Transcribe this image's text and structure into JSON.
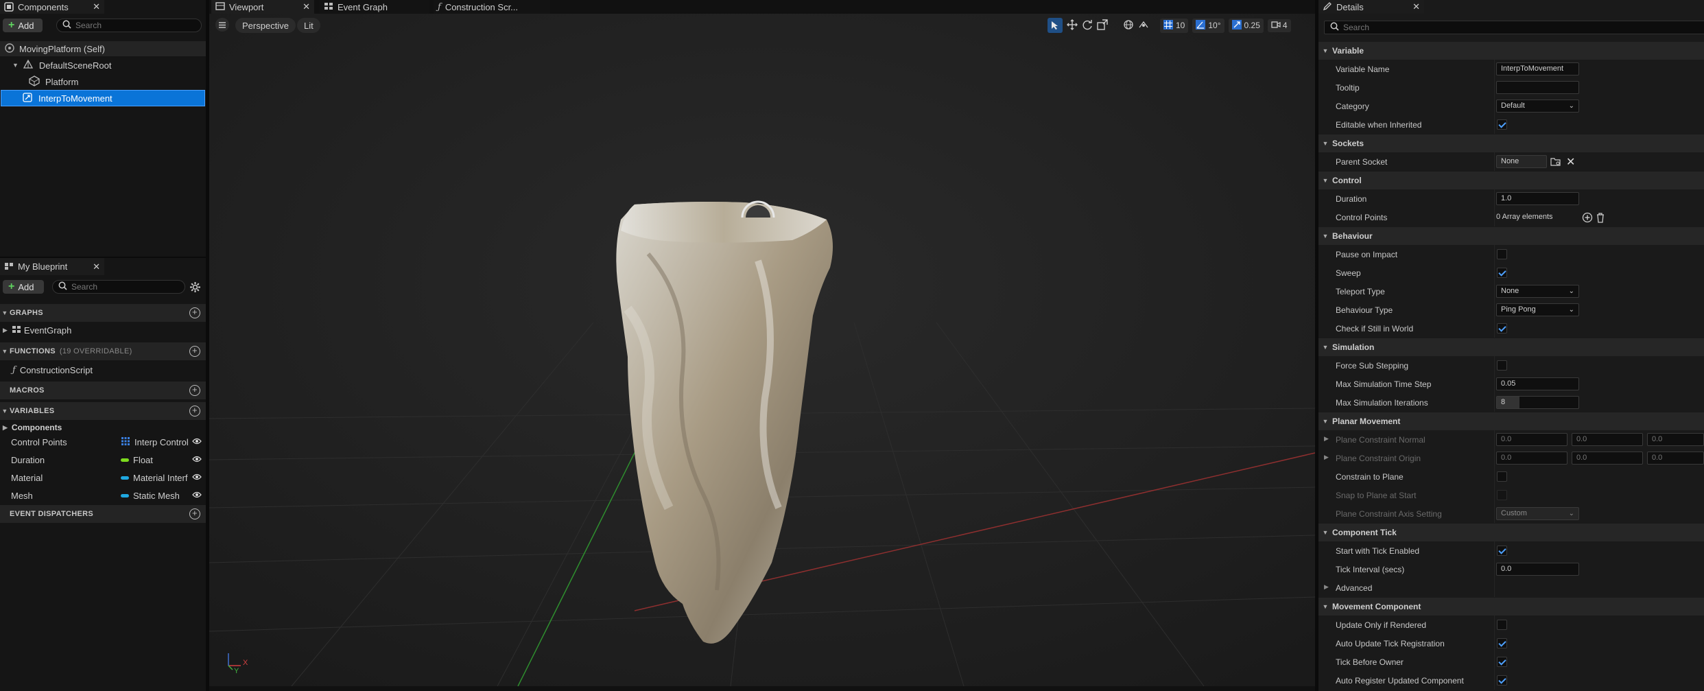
{
  "components_panel": {
    "tab_label": "Components",
    "add_label": "Add",
    "search_placeholder": "Search",
    "tree": [
      {
        "label": "MovingPlatform (Self)"
      },
      {
        "label": "DefaultSceneRoot"
      },
      {
        "label": "Platform"
      },
      {
        "label": "InterpToMovement"
      }
    ]
  },
  "blueprint_panel": {
    "tab_label": "My Blueprint",
    "add_label": "Add",
    "search_placeholder": "Search",
    "sections": {
      "graphs": "GRAPHS",
      "functions": "FUNCTIONS",
      "functions_sub": "(19 OVERRIDABLE)",
      "macros": "MACROS",
      "variables": "VARIABLES",
      "dispatchers": "EVENT DISPATCHERS"
    },
    "graph_items": [
      "EventGraph"
    ],
    "function_items": [
      "ConstructionScript"
    ],
    "variables_category": "Components",
    "variables": [
      {
        "name": "Control Points",
        "type": "Interp Control",
        "color": "#3a7fe0"
      },
      {
        "name": "Duration",
        "type": "Float",
        "color": "#7ddb1e"
      },
      {
        "name": "Material",
        "type": "Material Interf",
        "color": "#1fa8e0"
      },
      {
        "name": "Mesh",
        "type": "Static Mesh",
        "color": "#1fa8e0"
      }
    ]
  },
  "editor_tabs": [
    {
      "label": "Viewport"
    },
    {
      "label": "Event Graph"
    },
    {
      "label": "Construction Scr..."
    }
  ],
  "viewport": {
    "perspective_label": "Perspective",
    "lit_label": "Lit",
    "grid_snap": "10",
    "rotation_snap": "10°",
    "scale_snap": "0.25",
    "camera_speed": "4",
    "axis_labels": {
      "x": "X",
      "y": "Y"
    }
  },
  "details": {
    "tab_label": "Details",
    "search_placeholder": "Search",
    "sections": {
      "variable": "Variable",
      "sockets": "Sockets",
      "control": "Control",
      "behaviour": "Behaviour",
      "simulation": "Simulation",
      "planar": "Planar Movement",
      "tick": "Component Tick",
      "movement": "Movement Component"
    },
    "variable_name_label": "Variable Name",
    "variable_name_value": "InterpToMovement",
    "tooltip_label": "Tooltip",
    "tooltip_value": "",
    "category_label": "Category",
    "category_value": "Default",
    "editable_label": "Editable when Inherited",
    "parent_socket_label": "Parent Socket",
    "parent_socket_value": "None",
    "duration_label": "Duration",
    "duration_value": "1.0",
    "control_points_label": "Control Points",
    "control_points_value": "0 Array elements",
    "pause_label": "Pause on Impact",
    "sweep_label": "Sweep",
    "teleport_label": "Teleport Type",
    "teleport_value": "None",
    "behaviour_type_label": "Behaviour Type",
    "behaviour_type_value": "Ping Pong",
    "check_world_label": "Check if Still in World",
    "force_sub_label": "Force Sub Stepping",
    "max_step_label": "Max Simulation Time Step",
    "max_step_value": "0.05",
    "max_iter_label": "Max Simulation Iterations",
    "max_iter_value": "8",
    "max_iter_fill": 0.28,
    "plane_normal_label": "Plane Constraint Normal",
    "plane_normal_values": [
      "0.0",
      "0.0",
      "0.0"
    ],
    "plane_origin_label": "Plane Constraint Origin",
    "plane_origin_values": [
      "0.0",
      "0.0",
      "0.0"
    ],
    "constrain_label": "Constrain to Plane",
    "snap_label": "Snap to Plane at Start",
    "axis_setting_label": "Plane Constraint Axis Setting",
    "axis_setting_value": "Custom",
    "start_tick_label": "Start with Tick Enabled",
    "tick_interval_label": "Tick Interval (secs)",
    "tick_interval_value": "0.0",
    "advanced_label": "Advanced",
    "update_rendered_label": "Update Only if Rendered",
    "auto_update_label": "Auto Update Tick Registration",
    "tick_before_label": "Tick Before Owner",
    "auto_register_label": "Auto Register Updated Component"
  }
}
